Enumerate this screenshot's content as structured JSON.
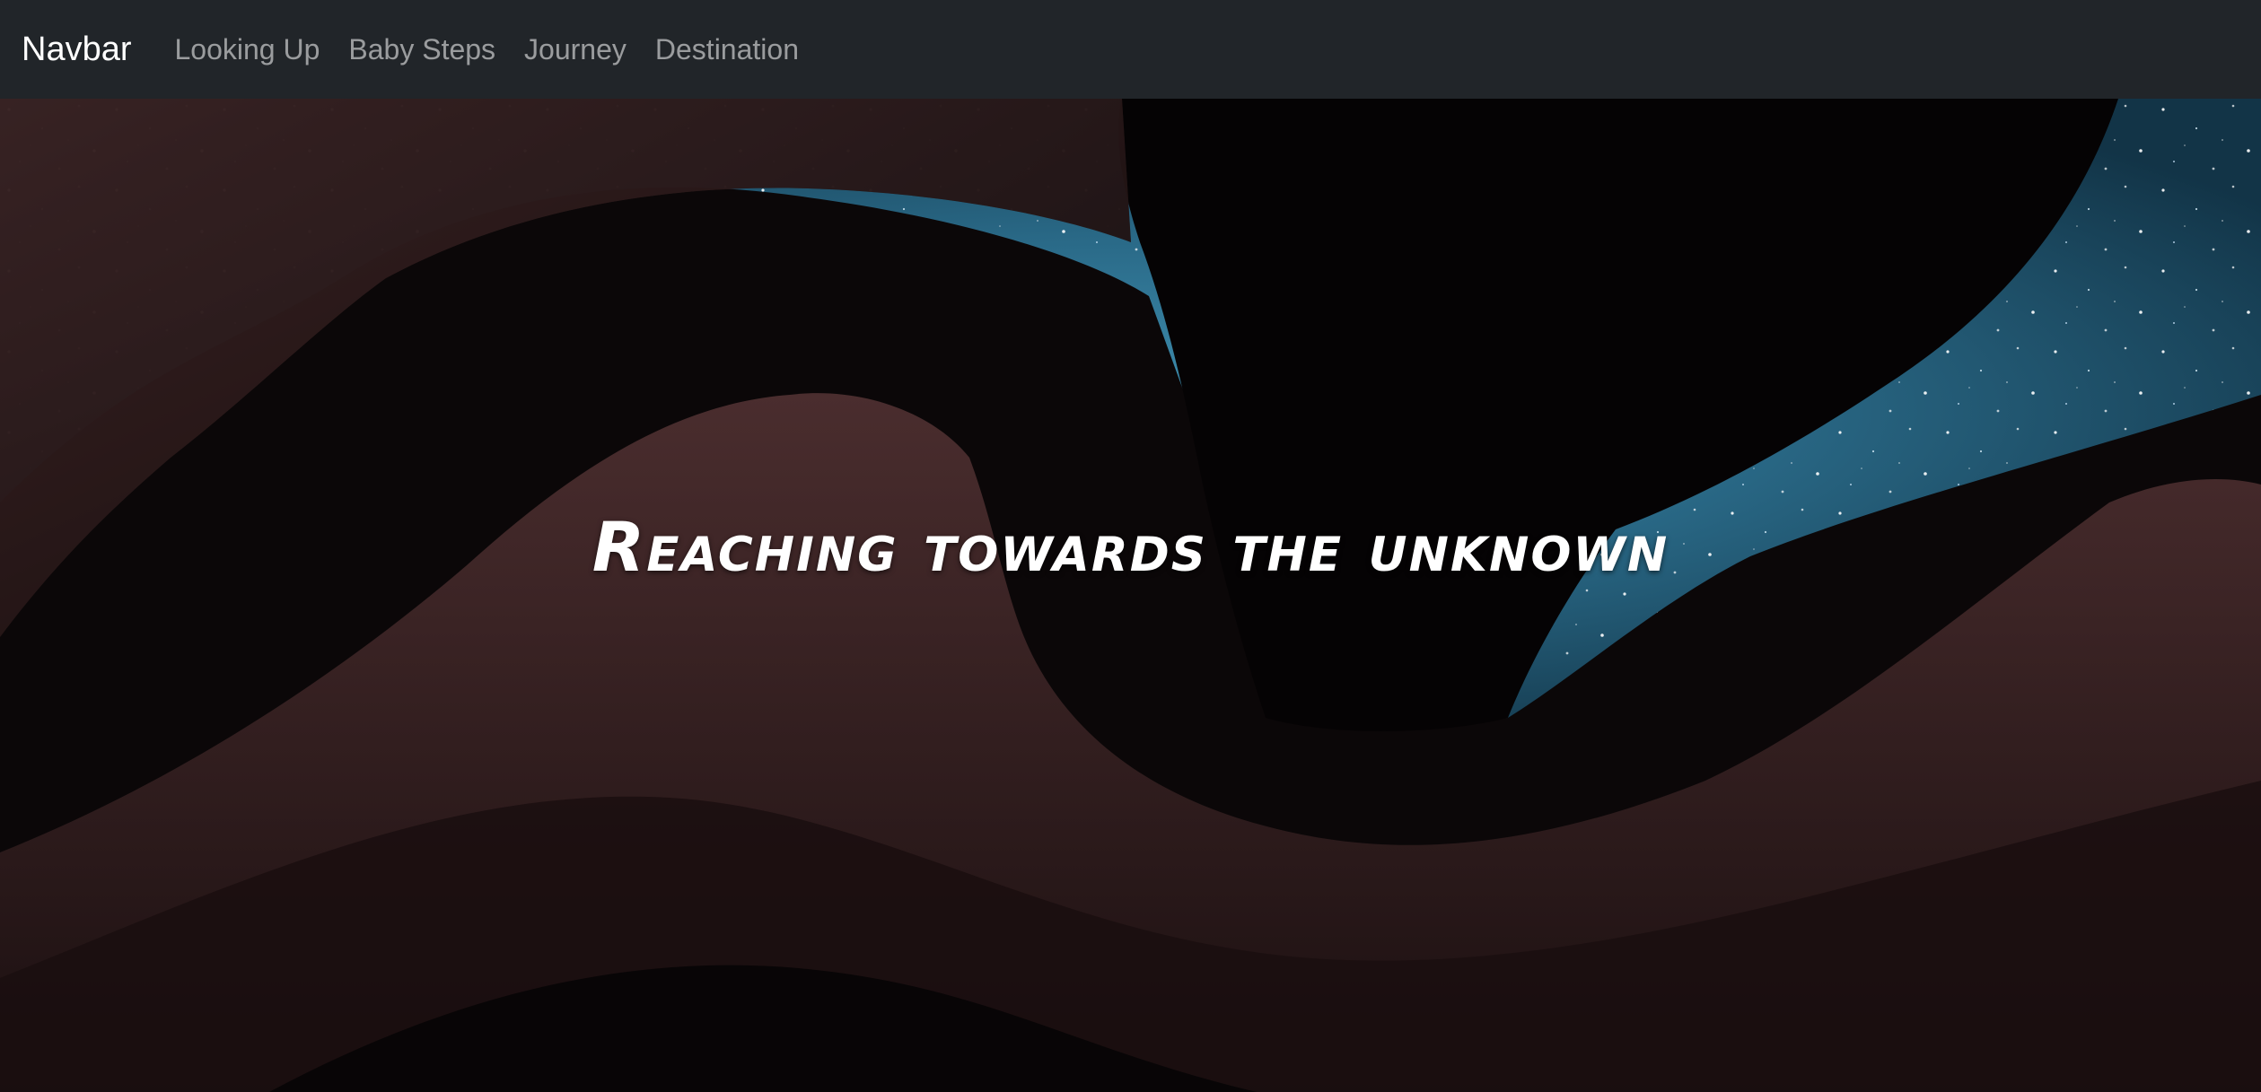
{
  "navbar": {
    "brand": "Navbar",
    "links": [
      {
        "label": "Looking Up"
      },
      {
        "label": "Baby Steps"
      },
      {
        "label": "Journey"
      },
      {
        "label": "Destination"
      }
    ]
  },
  "hero": {
    "title": "Reaching towards the unknown"
  },
  "colors": {
    "navbar_bg": "#212529",
    "sky": "#2a6f8f",
    "rock": "#3a2426"
  }
}
